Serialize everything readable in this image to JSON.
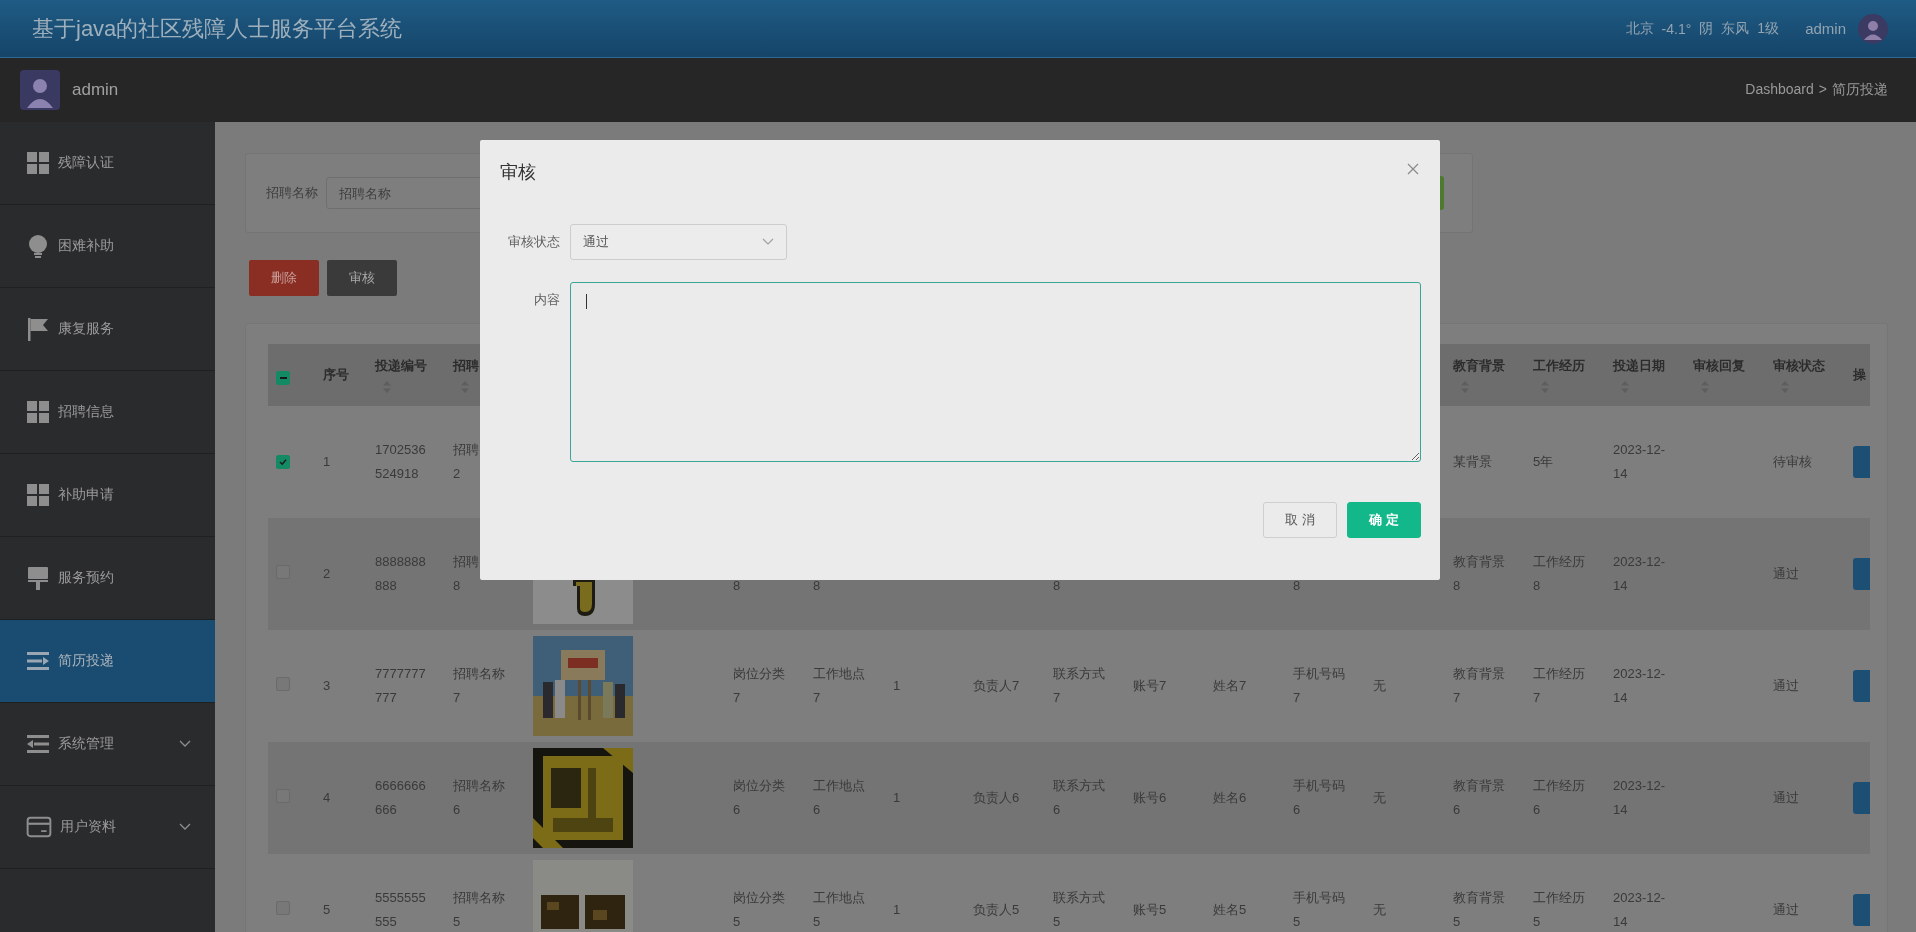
{
  "header": {
    "title": "基于java的社区残障人士服务平台系统",
    "weather": [
      "北京",
      "-4.1°",
      "阴",
      "东风",
      "1级"
    ],
    "user": "admin"
  },
  "subbar": {
    "user": "admin",
    "breadcrumb": {
      "items": [
        "Dashboard",
        "简历投递"
      ],
      "separator": ">"
    }
  },
  "sidebar": {
    "items": [
      {
        "label": "残障认证",
        "selected": false
      },
      {
        "label": "困难补助",
        "selected": false
      },
      {
        "label": "康复服务",
        "selected": false
      },
      {
        "label": "招聘信息",
        "selected": false
      },
      {
        "label": "补助申请",
        "selected": false
      },
      {
        "label": "服务预约",
        "selected": false
      },
      {
        "label": "简历投递",
        "selected": true
      },
      {
        "label": "系统管理",
        "selected": false,
        "expanded": false
      },
      {
        "label": "用户资料",
        "selected": false,
        "expanded": false
      }
    ]
  },
  "search": {
    "label": "招聘名称",
    "placeholder": "招聘名称"
  },
  "actions": [
    {
      "label": "删除",
      "kind": "danger"
    },
    {
      "label": "审核",
      "kind": "dark"
    }
  ],
  "table": {
    "select_all": {
      "indeterminate": true
    },
    "columns": [
      {
        "label": "序号",
        "sortable": false
      },
      {
        "label": "投递编号",
        "sortable": true
      },
      {
        "label": "招聘",
        "sortable": true
      },
      null,
      null,
      null,
      null,
      null,
      null,
      null,
      null,
      null,
      null,
      {
        "label": "教育背景",
        "sortable": true
      },
      {
        "label": "工作经历",
        "sortable": true
      },
      {
        "label": "投递日期",
        "sortable": true
      },
      {
        "label": "审核回复",
        "sortable": true
      },
      {
        "label": "审核状态",
        "sortable": true
      },
      {
        "label": "操",
        "sortable": false
      }
    ],
    "rows": [
      {
        "checked": true,
        "cells": [
          "1",
          "1702536524918",
          "招聘\n2",
          null,
          null,
          null,
          null,
          null,
          null,
          null,
          null,
          null,
          null,
          "某背景",
          "5年",
          "2023-12-14",
          null,
          "待审核",
          {
            "kind": "button"
          }
        ]
      },
      {
        "checked": false,
        "cells": [
          "2",
          "8888888888",
          "招聘\n8",
          {
            "kind": "picture"
          },
          "\n8",
          "\n8",
          null,
          null,
          "\n8",
          null,
          null,
          "\n8",
          null,
          "教育背景8",
          "工作经历8",
          "2023-12-14",
          null,
          "通过",
          {
            "kind": "button"
          }
        ]
      },
      {
        "checked": false,
        "cells": [
          "3",
          "7777777777",
          "招聘名称7",
          {
            "kind": "picture"
          },
          "岗位分类7",
          "工作地点7",
          "1",
          "负责人7",
          "联系方式7",
          "账号7",
          "姓名7",
          "手机号码7",
          "无",
          "教育背景7",
          "工作经历7",
          "2023-12-14",
          null,
          "通过",
          {
            "kind": "button"
          }
        ]
      },
      {
        "checked": false,
        "cells": [
          "4",
          "6666666666",
          "招聘名称6",
          {
            "kind": "picture"
          },
          "岗位分类6",
          "工作地点6",
          "1",
          "负责人6",
          "联系方式6",
          "账号6",
          "姓名6",
          "手机号码6",
          "无",
          "教育背景6",
          "工作经历6",
          "2023-12-14",
          null,
          "通过",
          {
            "kind": "button"
          }
        ]
      },
      {
        "checked": false,
        "cells": [
          "5",
          "5555555555",
          "招聘名称5",
          {
            "kind": "picture"
          },
          "岗位分类5",
          "工作地点5",
          "1",
          "负责人5",
          "联系方式5",
          "账号5",
          "姓名5",
          "手机号码5",
          "无",
          "教育背景5",
          "工作经历5",
          "2023-12-14",
          null,
          "通过",
          {
            "kind": "button"
          }
        ]
      }
    ]
  },
  "dialog": {
    "title": "审核",
    "fields": [
      {
        "label": "审核状态",
        "kind": "select",
        "value": "通过"
      },
      {
        "label": "内容",
        "kind": "textarea",
        "focused": true
      }
    ],
    "buttons": [
      {
        "label": "取 消",
        "kind": "default"
      },
      {
        "label": "确 定",
        "kind": "primary"
      }
    ]
  }
}
